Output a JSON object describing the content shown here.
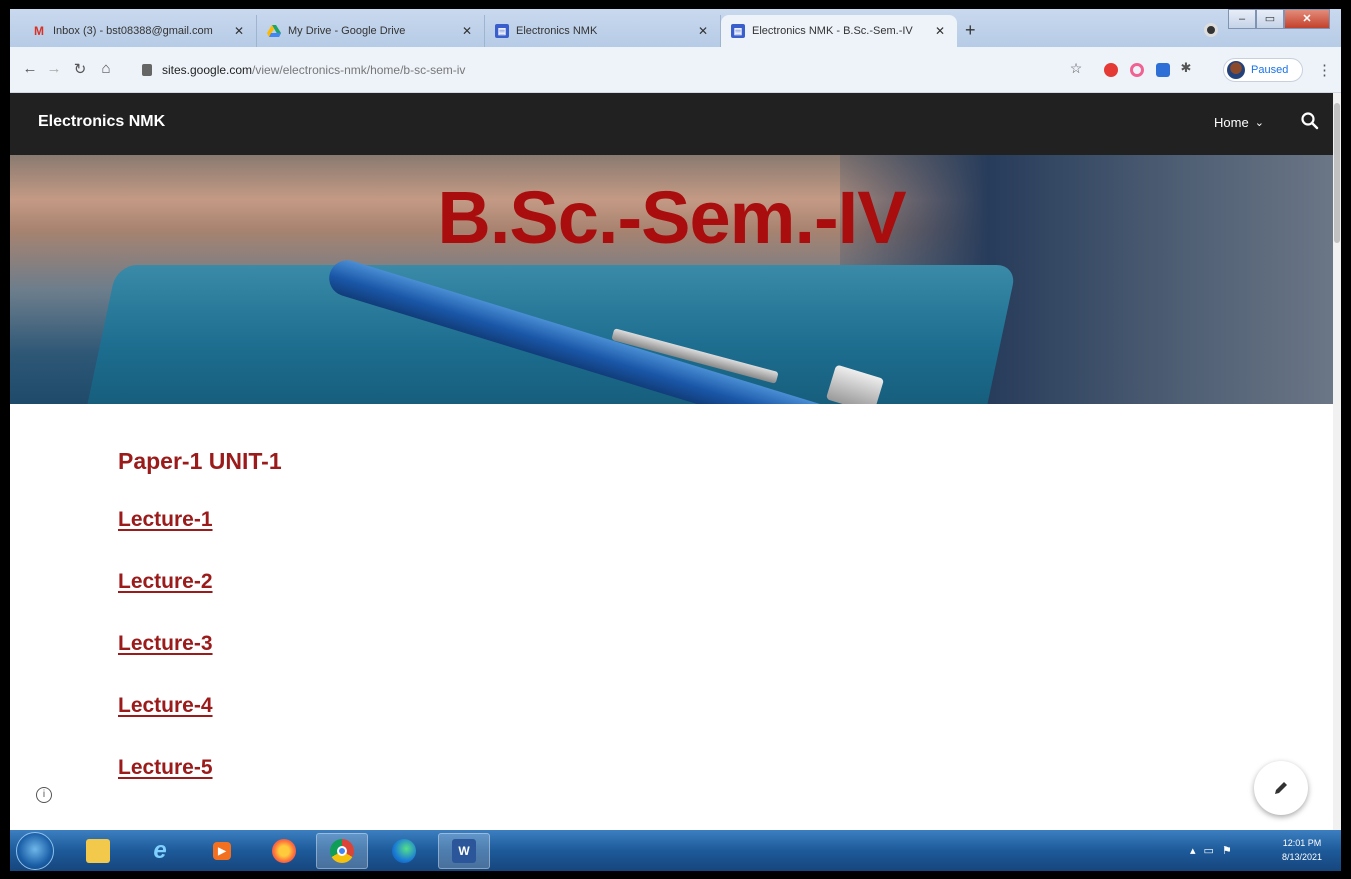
{
  "browser": {
    "tabs": [
      {
        "title": "Inbox (3) - bst08388@gmail.com",
        "icon": "gmail-icon",
        "icon_color": "#d93025"
      },
      {
        "title": "My Drive - Google Drive",
        "icon": "google-drive-icon",
        "icon_color": "#1fa463"
      },
      {
        "title": "Electronics NMK",
        "icon": "google-sites-icon",
        "icon_color": "#3a5fcd"
      },
      {
        "title": "Electronics NMK - B.Sc.-Sem.-IV",
        "icon": "google-sites-icon",
        "icon_color": "#3a5fcd"
      }
    ],
    "new_tab": "+",
    "url_host": "sites.google.com",
    "url_path": "/view/electronics-nmk/home/b-sc-sem-iv",
    "profile_status": "Paused"
  },
  "site": {
    "title": "Electronics NMK",
    "nav_home": "Home",
    "heading": "B.Sc.-Sem.-IV",
    "heading_color": "#a90d0d",
    "paper_heading": "Paper-1 UNIT-1",
    "lectures": [
      "Lecture-1",
      "Lecture-2",
      "Lecture-3",
      "Lecture-4",
      "Lecture-5"
    ],
    "link_color": "#9b1b1b"
  },
  "taskbar": {
    "apps": [
      "windows-explorer-icon",
      "internet-explorer-icon",
      "media-player-icon",
      "firefox-icon",
      "chrome-icon",
      "edge-icon",
      "word-icon"
    ],
    "time": "12:01 PM",
    "date": "8/13/2021"
  }
}
